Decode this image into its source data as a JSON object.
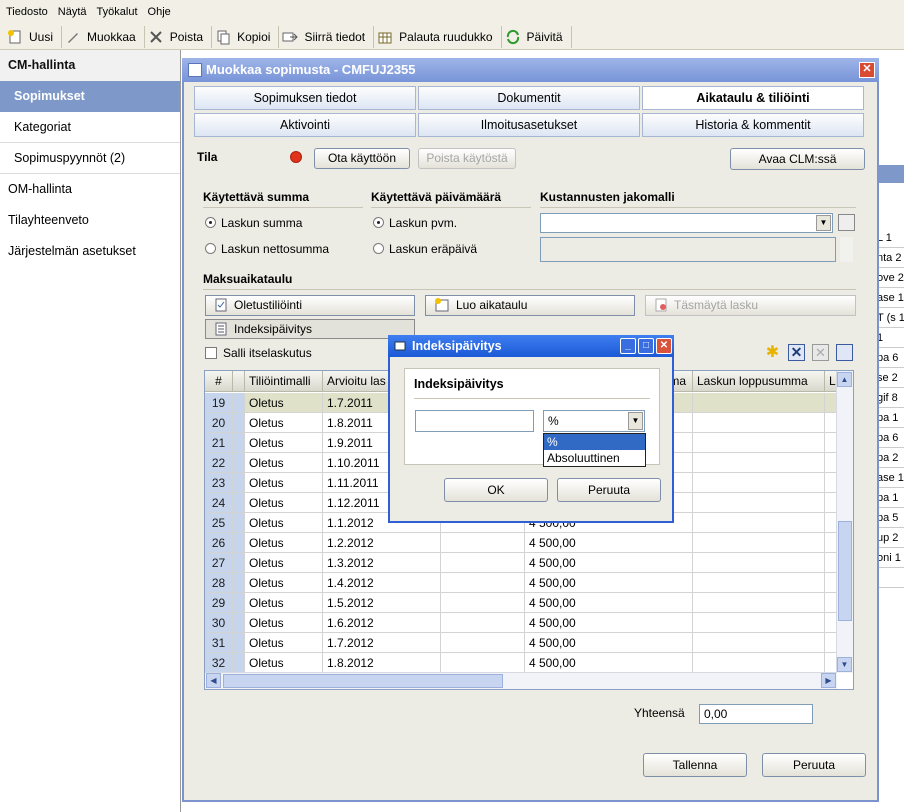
{
  "menu": [
    "Tiedosto",
    "Näytä",
    "Työkalut",
    "Ohje"
  ],
  "toolbar": {
    "new": "Uusi",
    "edit": "Muokkaa",
    "delete": "Poista",
    "copy": "Kopioi",
    "move": "Siirrä tiedot",
    "restore": "Palauta ruudukko",
    "refresh": "Päivitä"
  },
  "sidebar": {
    "cm": "CM-hallinta",
    "items": [
      "Sopimukset",
      "Kategoriat",
      "Sopimuspyynnöt (2)"
    ],
    "om": "OM-hallinta",
    "space": "Tilayhteenveto",
    "sys": "Järjestelmän asetukset"
  },
  "bg_col": [
    "L",
    "nta",
    "ove",
    "ase",
    "T (s",
    "",
    "pa",
    "se",
    "gif",
    "pa",
    "pa",
    "pa",
    "ase",
    "pa",
    "pa",
    "up",
    "oni",
    ""
  ],
  "bg_col2": [
    "1",
    "2",
    "2",
    "1",
    "1",
    "1",
    "6",
    "2",
    "8",
    "1",
    "6",
    "2",
    "1",
    "1",
    "5",
    "2",
    "1"
  ],
  "dialog": {
    "title": "Muokkaa sopimusta - CMFUJ2355",
    "close": "✕"
  },
  "tabs": {
    "r1": [
      "Sopimuksen tiedot",
      "Dokumentit",
      "Aikataulu & tiliöinti"
    ],
    "r2": [
      "Aktivointi",
      "Ilmoitusasetukset",
      "Historia & kommentit"
    ]
  },
  "status": {
    "label": "Tila",
    "activate": "Ota käyttöön",
    "deactivate": "Poista käytöstä",
    "open_clm": "Avaa CLM:ssä"
  },
  "sum": {
    "title": "Käytettävä summa",
    "opt1": "Laskun summa",
    "opt2": "Laskun nettosumma"
  },
  "date": {
    "title": "Käytettävä päivämäärä",
    "opt1": "Laskun pvm.",
    "opt2": "Laskun eräpäivä"
  },
  "cost": {
    "title": "Kustannusten jakomalli"
  },
  "schedule": {
    "title": "Maksuaikataulu",
    "default_acc": "Oletustiliöinti",
    "create": "Luo aikataulu",
    "match": "Täsmäytä lasku",
    "index": "Indeksipäivitys",
    "self_billing": "Salli itselaskutus"
  },
  "table": {
    "headers": [
      "#",
      "",
      "Tiliöintimalli",
      "Arvioitu las",
      "",
      "ma",
      "Laskun loppusumma",
      "L"
    ],
    "rows": [
      {
        "n": "19",
        "m": "Oletus",
        "d": "1.7.2011",
        "v": ""
      },
      {
        "n": "20",
        "m": "Oletus",
        "d": "1.8.2011",
        "v": ""
      },
      {
        "n": "21",
        "m": "Oletus",
        "d": "1.9.2011",
        "v": ""
      },
      {
        "n": "22",
        "m": "Oletus",
        "d": "1.10.2011",
        "v": ""
      },
      {
        "n": "23",
        "m": "Oletus",
        "d": "1.11.2011",
        "v": ""
      },
      {
        "n": "24",
        "m": "Oletus",
        "d": "1.12.2011",
        "v": ""
      },
      {
        "n": "25",
        "m": "Oletus",
        "d": "1.1.2012",
        "v": "4 500,00"
      },
      {
        "n": "26",
        "m": "Oletus",
        "d": "1.2.2012",
        "v": "4 500,00"
      },
      {
        "n": "27",
        "m": "Oletus",
        "d": "1.3.2012",
        "v": "4 500,00"
      },
      {
        "n": "28",
        "m": "Oletus",
        "d": "1.4.2012",
        "v": "4 500,00"
      },
      {
        "n": "29",
        "m": "Oletus",
        "d": "1.5.2012",
        "v": "4 500,00"
      },
      {
        "n": "30",
        "m": "Oletus",
        "d": "1.6.2012",
        "v": "4 500,00"
      },
      {
        "n": "31",
        "m": "Oletus",
        "d": "1.7.2012",
        "v": "4 500,00"
      },
      {
        "n": "32",
        "m": "Oletus",
        "d": "1.8.2012",
        "v": "4 500,00"
      }
    ]
  },
  "total": {
    "label": "Yhteensä",
    "value": "0,00"
  },
  "footer": {
    "save": "Tallenna",
    "cancel": "Peruuta"
  },
  "index_dialog": {
    "title": "Indeksipäivitys",
    "group": "Indeksipäivitys",
    "selected": "%",
    "options": [
      "%",
      "Absoluuttinen"
    ],
    "ok": "OK",
    "cancel": "Peruuta",
    "input_value": ""
  }
}
